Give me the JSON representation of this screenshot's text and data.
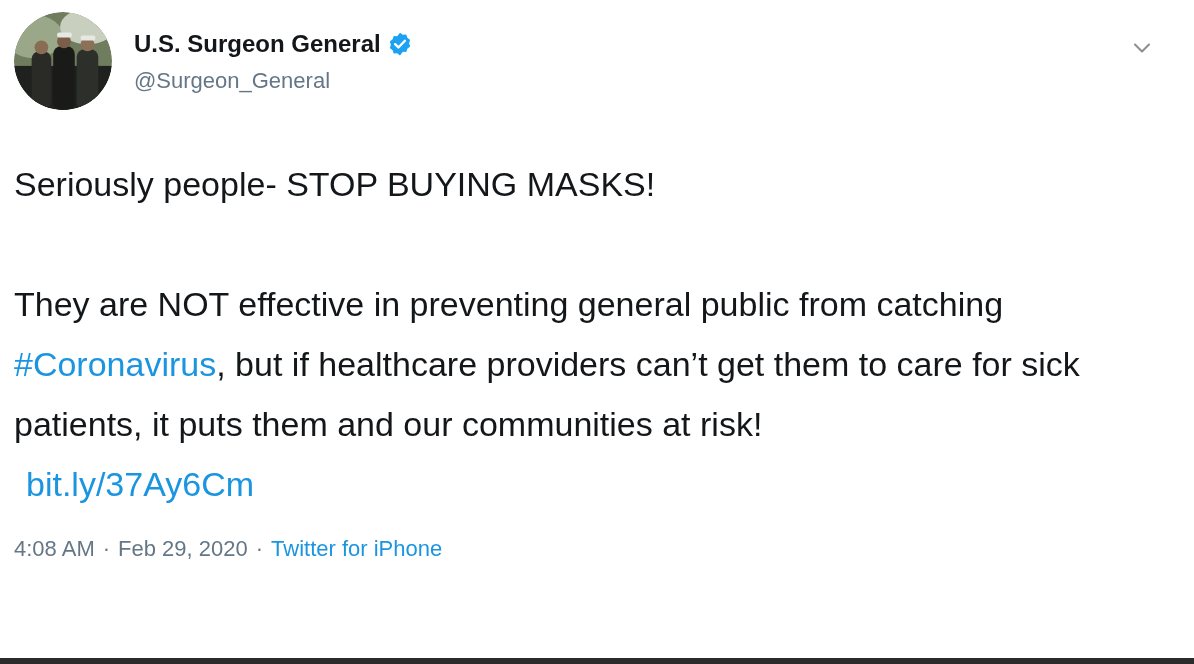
{
  "author": {
    "name": "U.S. Surgeon General",
    "verified": true,
    "handle": "@Surgeon_General"
  },
  "body": [
    {
      "kind": "text",
      "text": "Seriously people- STOP BUYING MASKS!"
    },
    {
      "kind": "rich",
      "before": "They are NOT effective in preventing general public from catching ",
      "hashtag": "#Coronavirus",
      "after": ", but if healthcare providers can’t get them to care for sick patients, it puts them and our communities at risk!"
    },
    {
      "kind": "link",
      "text": "bit.ly/37Ay6Cm"
    }
  ],
  "footer": [
    {
      "kind": "text",
      "text": "4:08 AM"
    },
    {
      "kind": "separator",
      "text": "·"
    },
    {
      "kind": "text",
      "text": "Feb 29, 2020"
    },
    {
      "kind": "separator",
      "text": "·"
    },
    {
      "kind": "link",
      "text": "Twitter for iPhone"
    }
  ]
}
